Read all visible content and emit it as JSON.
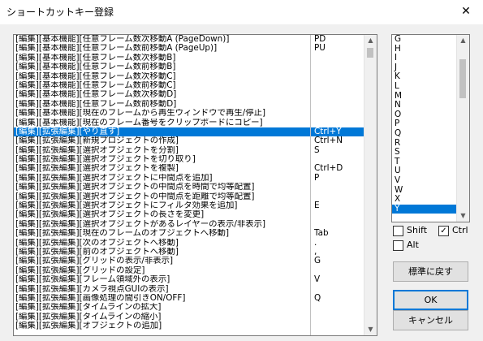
{
  "window": {
    "title": "ショートカットキー登録",
    "close_glyph": "✕"
  },
  "commands": [
    {
      "name": "[編集][基本機能][任意フレーム数次移動A (PageDown)]",
      "key": "PD"
    },
    {
      "name": "[編集][基本機能][任意フレーム数前移動A (PageUp)]",
      "key": "PU"
    },
    {
      "name": "[編集][基本機能][任意フレーム数次移動B]",
      "key": ""
    },
    {
      "name": "[編集][基本機能][任意フレーム数前移動B]",
      "key": ""
    },
    {
      "name": "[編集][基本機能][任意フレーム数次移動C]",
      "key": ""
    },
    {
      "name": "[編集][基本機能][任意フレーム数前移動C]",
      "key": ""
    },
    {
      "name": "[編集][基本機能][任意フレーム数次移動D]",
      "key": ""
    },
    {
      "name": "[編集][基本機能][任意フレーム数前移動D]",
      "key": ""
    },
    {
      "name": "[編集][基本機能][現在のフレームから再生ウィンドウで再生/停止]",
      "key": ""
    },
    {
      "name": "[編集][基本機能][現在のフレーム番号をクリップボードにコピー]",
      "key": ""
    },
    {
      "name": "[編集][拡張編集][やり直す]",
      "key": "Ctrl+Y"
    },
    {
      "name": "[編集][拡張編集][新規プロジェクトの作成]",
      "key": "Ctrl+N"
    },
    {
      "name": "[編集][拡張編集][選択オブジェクトを分割]",
      "key": "S"
    },
    {
      "name": "[編集][拡張編集][選択オブジェクトを切り取り]",
      "key": ""
    },
    {
      "name": "[編集][拡張編集][選択オブジェクトを複製]",
      "key": "Ctrl+D"
    },
    {
      "name": "[編集][拡張編集][選択オブジェクトに中間点を追加]",
      "key": "P"
    },
    {
      "name": "[編集][拡張編集][選択オブジェクトの中間点を時間で均等配置]",
      "key": ""
    },
    {
      "name": "[編集][拡張編集][選択オブジェクトの中間点を距離で均等配置]",
      "key": ""
    },
    {
      "name": "[編集][拡張編集][選択オブジェクトにフィルタ効果を追加]",
      "key": "E"
    },
    {
      "name": "[編集][拡張編集][選択オブジェクトの長さを変更]",
      "key": ""
    },
    {
      "name": "[編集][拡張編集][選択オブジェクトがあるレイヤーの表示/非表示]",
      "key": ""
    },
    {
      "name": "[編集][拡張編集][現在のフレームのオブジェクトへ移動]",
      "key": "Tab"
    },
    {
      "name": "[編集][拡張編集][次のオブジェクトへ移動]",
      "key": "."
    },
    {
      "name": "[編集][拡張編集][前のオブジェクトへ移動]",
      "key": ","
    },
    {
      "name": "[編集][拡張編集][グリッドの表示/非表示]",
      "key": "G"
    },
    {
      "name": "[編集][拡張編集][グリッドの設定]",
      "key": ""
    },
    {
      "name": "[編集][拡張編集][フレーム領域外の表示]",
      "key": "V"
    },
    {
      "name": "[編集][拡張編集][カメラ視点GUIの表示]",
      "key": ""
    },
    {
      "name": "[編集][拡張編集][画像処理の間引きON/OFF]",
      "key": "Q"
    },
    {
      "name": "[編集][拡張編集][タイムラインの拡大]",
      "key": ""
    },
    {
      "name": "[編集][拡張編集][タイムラインの縮小]",
      "key": ""
    },
    {
      "name": "[編集][拡張編集][オブジェクトの追加]",
      "key": ""
    }
  ],
  "selected_command": 10,
  "keys": [
    "G",
    "H",
    "I",
    "J",
    "K",
    "L",
    "M",
    "N",
    "O",
    "P",
    "Q",
    "R",
    "S",
    "T",
    "U",
    "V",
    "W",
    "X",
    "Y"
  ],
  "selected_key": 18,
  "modifiers": {
    "shift": {
      "label": "Shift",
      "checked": false
    },
    "ctrl": {
      "label": "Ctrl",
      "checked": true
    },
    "alt": {
      "label": "Alt",
      "checked": false
    }
  },
  "buttons": {
    "reset": "標準に戻す",
    "ok": "OK",
    "cancel": "キャンセル"
  },
  "scroll_arrows": {
    "up": "▲",
    "down": "▼"
  },
  "colors": {
    "selection": "#0078d7",
    "dialog_bg": "#f0f0f0"
  }
}
